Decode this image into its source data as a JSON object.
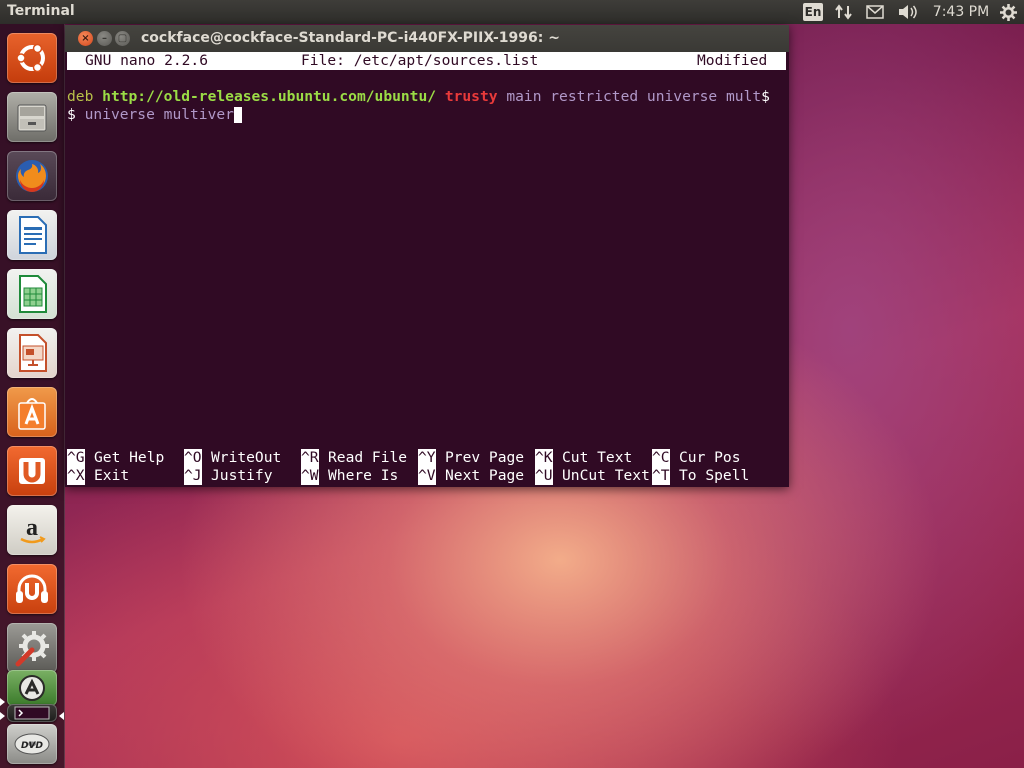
{
  "top_panel": {
    "app_name": "Terminal",
    "keyboard_layout": "En",
    "clock": "7:43 PM",
    "icons": [
      "keyboard-icon",
      "network-icon",
      "mail-icon",
      "volume-icon",
      "settings-gear-icon"
    ]
  },
  "launcher": {
    "items": [
      {
        "name": "dash-home",
        "icon": "ubuntu-logo-icon",
        "color": "#dd4814"
      },
      {
        "name": "files",
        "icon": "file-cabinet-icon",
        "color": "#8a8a84"
      },
      {
        "name": "firefox",
        "icon": "firefox-icon",
        "color": "#e66000"
      },
      {
        "name": "libreoffice-writer",
        "icon": "writer-icon",
        "color": "#2a6db5"
      },
      {
        "name": "libreoffice-calc",
        "icon": "calc-icon",
        "color": "#1f8a3a"
      },
      {
        "name": "libreoffice-impress",
        "icon": "impress-icon",
        "color": "#c4502b"
      },
      {
        "name": "ubuntu-software-center",
        "icon": "shopping-bag-icon",
        "color": "#e8762b"
      },
      {
        "name": "ubuntu-one",
        "icon": "ubuntu-one-icon",
        "color": "#e05a24"
      },
      {
        "name": "amazon",
        "icon": "amazon-icon",
        "color": "#e6e2d8"
      },
      {
        "name": "ubuntu-one-music",
        "icon": "headphones-icon",
        "color": "#e05a24"
      },
      {
        "name": "system-settings",
        "icon": "wrench-gear-icon",
        "color": "#8c8c88"
      },
      {
        "name": "software-updater",
        "icon": "updater-icon",
        "color": "#4a8c3a"
      },
      {
        "name": "terminal",
        "icon": "terminal-icon",
        "color": "#2a2a28"
      },
      {
        "name": "dvd",
        "icon": "dvd-icon",
        "color": "#9a9a96"
      }
    ]
  },
  "window": {
    "title": "cockface@cockface-Standard-PC-i440FX-PIIX-1996: ~",
    "close_label": "×",
    "minimize_label": "–",
    "maximize_label": "▢"
  },
  "nano": {
    "version": "GNU nano 2.2.6",
    "file_label": "File: /etc/apt/sources.list",
    "status": "Modified",
    "line1": {
      "deb": "deb",
      "url": "http://old-releases.ubuntu.com/ubuntu/",
      "suite": "trusty",
      "components": "main restricted universe mult",
      "overflow": "$"
    },
    "line2": {
      "marker": "$",
      "text": " universe multiver"
    },
    "shortcuts_row1": [
      {
        "key": "^G",
        "label": "Get Help"
      },
      {
        "key": "^O",
        "label": "WriteOut"
      },
      {
        "key": "^R",
        "label": "Read File"
      },
      {
        "key": "^Y",
        "label": "Prev Page"
      },
      {
        "key": "^K",
        "label": "Cut Text"
      },
      {
        "key": "^C",
        "label": "Cur Pos"
      }
    ],
    "shortcuts_row2": [
      {
        "key": "^X",
        "label": "Exit"
      },
      {
        "key": "^J",
        "label": "Justify"
      },
      {
        "key": "^W",
        "label": "Where Is"
      },
      {
        "key": "^V",
        "label": "Next Page"
      },
      {
        "key": "^U",
        "label": "UnCut Text"
      },
      {
        "key": "^T",
        "label": "To Spell"
      }
    ]
  }
}
